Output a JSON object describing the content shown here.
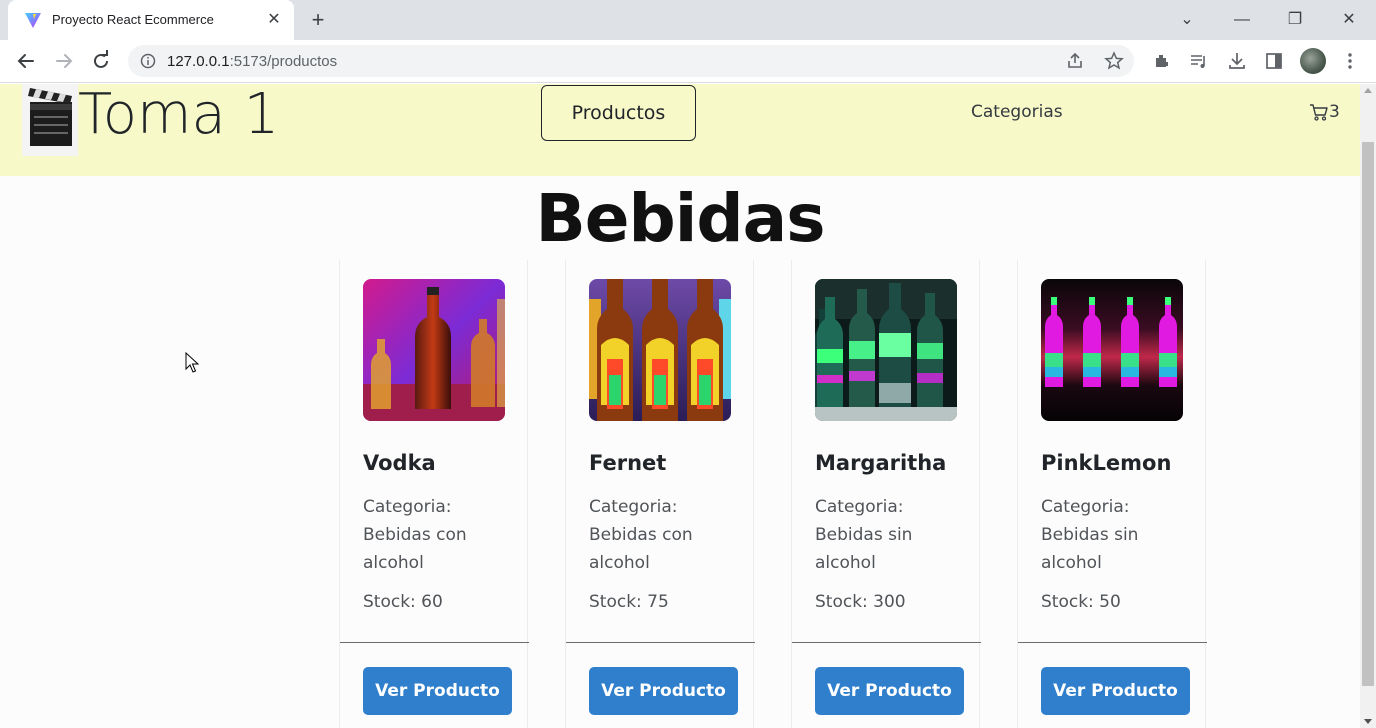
{
  "browser": {
    "tab_title": "Proyecto React Ecommerce",
    "url_host": "127.0.0.1",
    "url_rest": ":5173/productos"
  },
  "navbar": {
    "brand": "Toma 1",
    "productos_label": "Productos",
    "categorias_label": "Categorias",
    "cart_count": "3",
    "background": "#f7f9c8"
  },
  "page": {
    "title": "Bebidas"
  },
  "products": [
    {
      "name": "Vodka",
      "categoria_label": "Categoria:",
      "categoria": "Bebidas con alcohol",
      "stock": "Stock: 60",
      "button": "Ver Producto"
    },
    {
      "name": "Fernet",
      "categoria_label": "Categoria:",
      "categoria": "Bebidas con alcohol",
      "stock": "Stock: 75",
      "button": "Ver Producto"
    },
    {
      "name": "Margaritha",
      "categoria_label": "Categoria:",
      "categoria": "Bebidas sin alcohol",
      "stock": "Stock: 300",
      "button": "Ver Producto"
    },
    {
      "name": "PinkLemon",
      "categoria_label": "Categoria:",
      "categoria": "Bebidas sin alcohol",
      "stock": "Stock: 50",
      "button": "Ver Producto"
    }
  ],
  "colors": {
    "button_blue": "#2f7fcc"
  }
}
